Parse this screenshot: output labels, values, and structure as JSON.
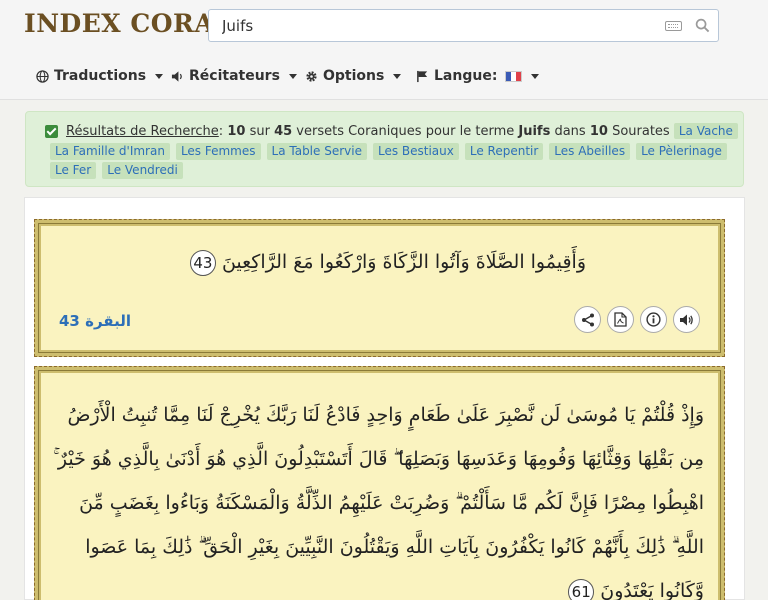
{
  "header": {
    "logo": "INDEX CORAN",
    "search_value": "Juifs",
    "search_placeholder": ""
  },
  "nav": {
    "translations": "Traductions",
    "reciters": "Récitateurs",
    "options": "Options",
    "language": "Langue:"
  },
  "results": {
    "link": "Résultats de Recherche",
    "sep": ":",
    "count": "10",
    "t1": "sur",
    "total": "45",
    "t2": "versets Coraniques pour le terme",
    "term": "Juifs",
    "t3": "dans",
    "surah_count": "10",
    "t4": "Sourates",
    "surahs": [
      "La Vache",
      "La Famille d'Imran",
      "Les Femmes",
      "La Table Servie",
      "Les Bestiaux",
      "Le Repentir",
      "Les Abeilles",
      "Le Pèlerinage",
      "Le Fer",
      "Le Vendredi"
    ]
  },
  "verses": [
    {
      "lines": [
        "وَأَقِيمُوا الصَّلَاةَ وَآتُوا الزَّكَاةَ وَارْكَعُوا مَعَ الرَّاكِعِينَ"
      ],
      "number": "43",
      "reference": "البقرة 43"
    },
    {
      "lines": [
        "وَإِذْ قُلْتُمْ يَا مُوسَىٰ لَن نَّصْبِرَ عَلَىٰ طَعَامٍ وَاحِدٍ فَادْعُ لَنَا رَبَّكَ يُخْرِجْ لَنَا مِمَّا تُنبِتُ الْأَرْضُ",
        "مِن بَقْلِهَا وَقِثَّائِهَا وَفُومِهَا وَعَدَسِهَا وَبَصَلِهَا ۖ قَالَ أَتَسْتَبْدِلُونَ الَّذِي هُوَ أَدْنَىٰ بِالَّذِي هُوَ خَيْرٌ ۚ",
        "اهْبِطُوا مِصْرًا فَإِنَّ لَكُم مَّا سَأَلْتُمْ ۗ وَضُرِبَتْ عَلَيْهِمُ الذِّلَّةُ وَالْمَسْكَنَةُ وَبَاءُوا بِغَضَبٍ مِّنَ",
        "اللَّهِ ۗ ذَٰلِكَ بِأَنَّهُمْ كَانُوا يَكْفُرُونَ بِآيَاتِ اللَّهِ وَيَقْتُلُونَ النَّبِيِّينَ بِغَيْرِ الْحَقِّ ۗ ذَٰلِكَ بِمَا عَصَوا",
        "وَّكَانُوا يَعْتَدُونَ"
      ],
      "number": "61"
    }
  ],
  "colors": {
    "logo": "#6b4f22",
    "alert_bg": "#dff0d8",
    "tag_bg": "#c6e1bb",
    "link_blue": "#2d6fb8",
    "verse_bg": "#faf3c0",
    "verse_border": "#cdbd6e"
  },
  "icons": {
    "search": "search-icon",
    "keyboard": "keyboard-icon",
    "globe": "globe-icon",
    "volume": "volume-icon",
    "gear": "gear-icon",
    "flag": "flag-icon",
    "share": "share-icon",
    "pdf": "pdf-icon",
    "info": "info-icon",
    "audio": "audio-icon"
  }
}
